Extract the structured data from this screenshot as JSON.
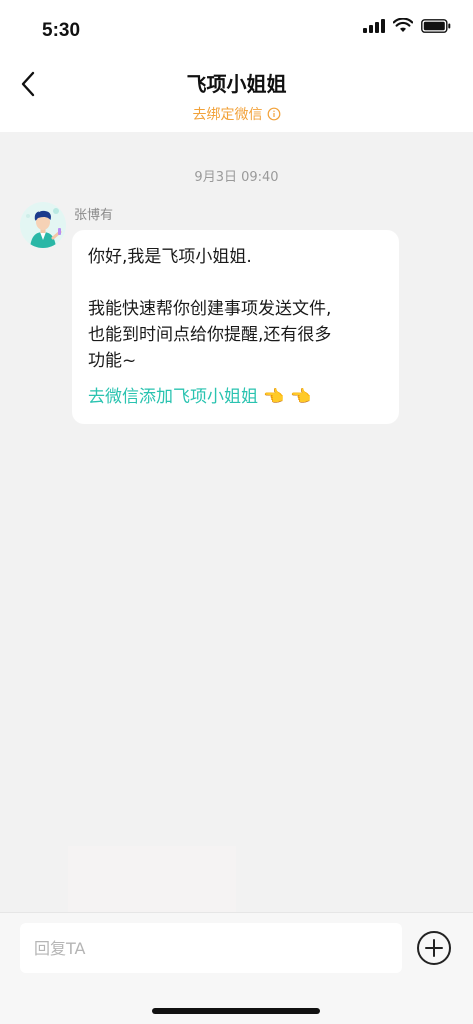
{
  "status_bar": {
    "time": "5:30",
    "icons": [
      "signal-icon",
      "wifi-icon",
      "battery-icon"
    ]
  },
  "header": {
    "back_icon": "chevron-left-icon",
    "title": "飞项小姐姐",
    "bind_link": "去绑定微信",
    "bind_icon": "info-circle-icon"
  },
  "chat": {
    "timestamp": "9月3日 09:40",
    "message": {
      "sender": "张博有",
      "avatar_icon": "avatar-illustration",
      "lines": [
        "你好,我是飞项小姐姐.",
        "",
        "我能快速帮你创建事项发送文件,",
        "也能到时间点给你提醒,还有很多",
        "功能~"
      ],
      "link": "去微信添加飞项小姐姐 👈 👈"
    }
  },
  "input_bar": {
    "placeholder": "回复TA",
    "add_icon": "plus-circle-icon"
  },
  "colors": {
    "accent_orange": "#f2a23a",
    "link_teal": "#2ac3b0",
    "background": "#f2f2f2"
  }
}
